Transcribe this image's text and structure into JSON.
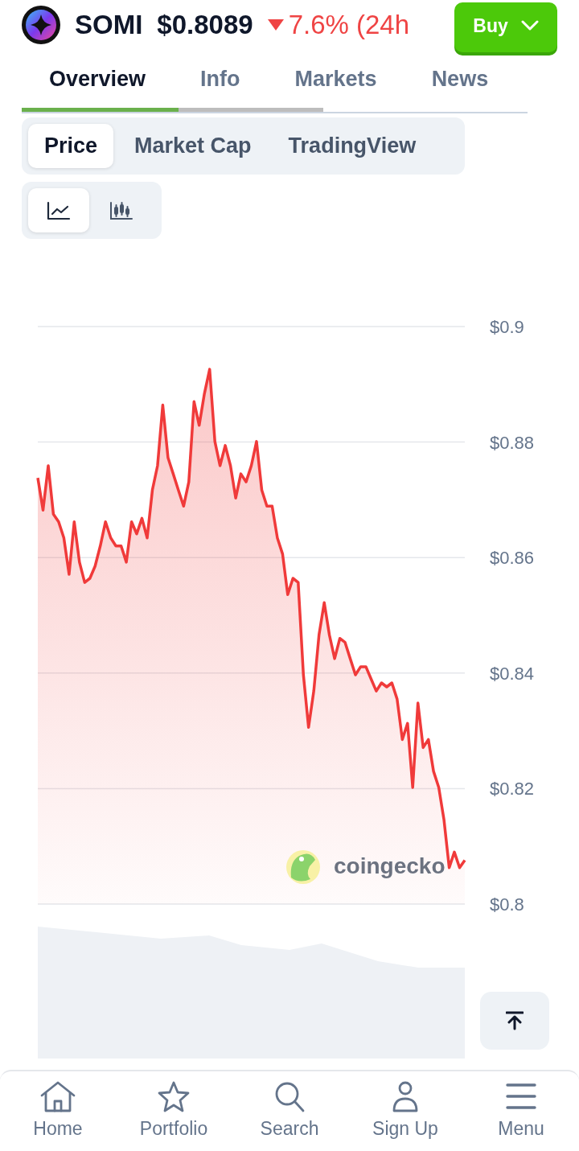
{
  "header": {
    "coin": "SOMI",
    "price": "$0.8089",
    "change": "7.6% (24h",
    "falling": true,
    "buy_button": "Buy"
  },
  "tabs": [
    {
      "label": "Overview",
      "selected": true
    },
    {
      "label": "Info",
      "selected": false
    },
    {
      "label": "Markets",
      "selected": false
    },
    {
      "label": "News",
      "selected": false
    }
  ],
  "chart_tabs": [
    {
      "label": "Price",
      "selected": true
    },
    {
      "label": "Market Cap",
      "selected": false
    },
    {
      "label": "TradingView",
      "selected": false
    }
  ],
  "chart_types": [
    {
      "kind": "line",
      "selected": true
    },
    {
      "kind": "candlestick",
      "selected": false
    }
  ],
  "chart": {
    "brand": "coingecko",
    "chart_data": {
      "type": "area",
      "grid": true,
      "ylim": [
        0.8,
        0.9
      ],
      "yticks": [
        {
          "value": 0.9,
          "label": "$0.9"
        },
        {
          "value": 0.88,
          "label": "$0.88"
        },
        {
          "value": 0.86,
          "label": "$0.86"
        },
        {
          "value": 0.84,
          "label": "$0.84"
        },
        {
          "value": 0.82,
          "label": "$0.82"
        },
        {
          "value": 0.8,
          "label": "$0.8"
        }
      ],
      "series": [
        {
          "color": "#f03a3a",
          "values": [
            0.8738,
            0.8682,
            0.8759,
            0.8675,
            0.8662,
            0.8634,
            0.8571,
            0.8662,
            0.8592,
            0.8557,
            0.8564,
            0.8585,
            0.862,
            0.8662,
            0.8634,
            0.862,
            0.862,
            0.8592,
            0.8662,
            0.8641,
            0.8668,
            0.8634,
            0.8717,
            0.8759,
            0.8864,
            0.8773,
            0.8745,
            0.8717,
            0.8689,
            0.8731,
            0.887,
            0.8829,
            0.8884,
            0.8926,
            0.8801,
            0.8759,
            0.8794,
            0.8759,
            0.8703,
            0.8745,
            0.8731,
            0.8759,
            0.8801,
            0.8717,
            0.8689,
            0.8689,
            0.8634,
            0.8606,
            0.8536,
            0.8564,
            0.8557,
            0.8397,
            0.8306,
            0.8369,
            0.8466,
            0.8522,
            0.8466,
            0.8425,
            0.846,
            0.8453,
            0.8425,
            0.8397,
            0.8411,
            0.8411,
            0.839,
            0.8369,
            0.8383,
            0.8376,
            0.8383,
            0.8355,
            0.8285,
            0.8313,
            0.8202,
            0.8348,
            0.8271,
            0.8285,
            0.823,
            0.8202,
            0.8146,
            0.8063,
            0.809,
            0.8063,
            0.8076
          ]
        }
      ]
    }
  },
  "nav": [
    {
      "label": "Home",
      "kind": "home"
    },
    {
      "label": "Portfolio",
      "kind": "star"
    },
    {
      "label": "Search",
      "kind": "search"
    },
    {
      "label": "Sign Up",
      "kind": "user"
    },
    {
      "label": "Menu",
      "kind": "menu"
    }
  ]
}
